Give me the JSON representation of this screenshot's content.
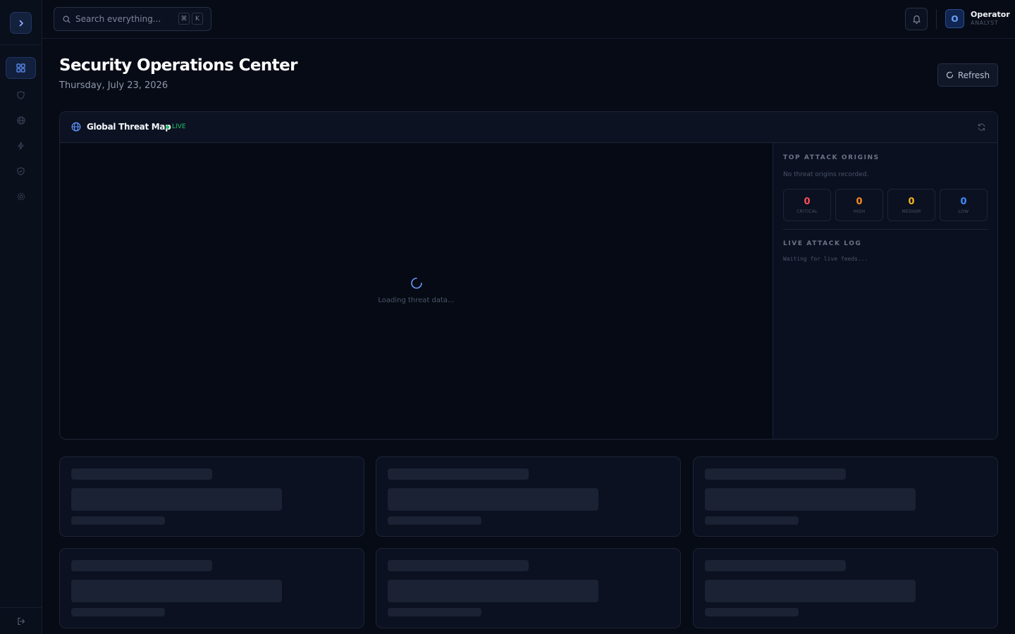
{
  "sidebar": {
    "toggle_icon": "chevron-right-icon",
    "items": [
      {
        "icon": "dashboard-grid-icon",
        "active": true
      },
      {
        "icon": "shield-icon",
        "active": false
      },
      {
        "icon": "globe-icon",
        "active": false
      },
      {
        "icon": "lightning-icon",
        "active": false
      },
      {
        "icon": "shield-check-icon",
        "active": false
      },
      {
        "icon": "gear-icon",
        "active": false
      }
    ],
    "logout_icon": "logout-icon"
  },
  "topbar": {
    "search_placeholder": "Search everything...",
    "shortcut_keys": [
      "⌘",
      "K"
    ],
    "notification_icon": "bell-icon",
    "user": {
      "initial": "O",
      "name": "Operator",
      "role": "ANALYST"
    }
  },
  "page": {
    "title": "Security Operations Center",
    "date": "Thursday, July 23, 2026",
    "refresh_label": "Refresh"
  },
  "threat_map": {
    "title": "Global Threat Map",
    "live_label": "LIVE",
    "loading_text": "Loading threat data...",
    "top_attack_origins": {
      "heading": "TOP ATTACK ORIGINS",
      "empty_text": "No threat origins recorded."
    },
    "severity_counts": [
      {
        "label": "CRITICAL",
        "value": "0",
        "color": "#ff4d57"
      },
      {
        "label": "HIGH",
        "value": "0",
        "color": "#ff8a1f"
      },
      {
        "label": "MEDIUM",
        "value": "0",
        "color": "#f5b51c"
      },
      {
        "label": "LOW",
        "value": "0",
        "color": "#3e8bff"
      }
    ],
    "live_attack_log": {
      "heading": "LIVE ATTACK LOG",
      "waiting_text": "Waiting for live feeds..."
    }
  },
  "colors": {
    "background": "#070b16",
    "accent": "#3e8bff",
    "live": "#22c36e"
  }
}
